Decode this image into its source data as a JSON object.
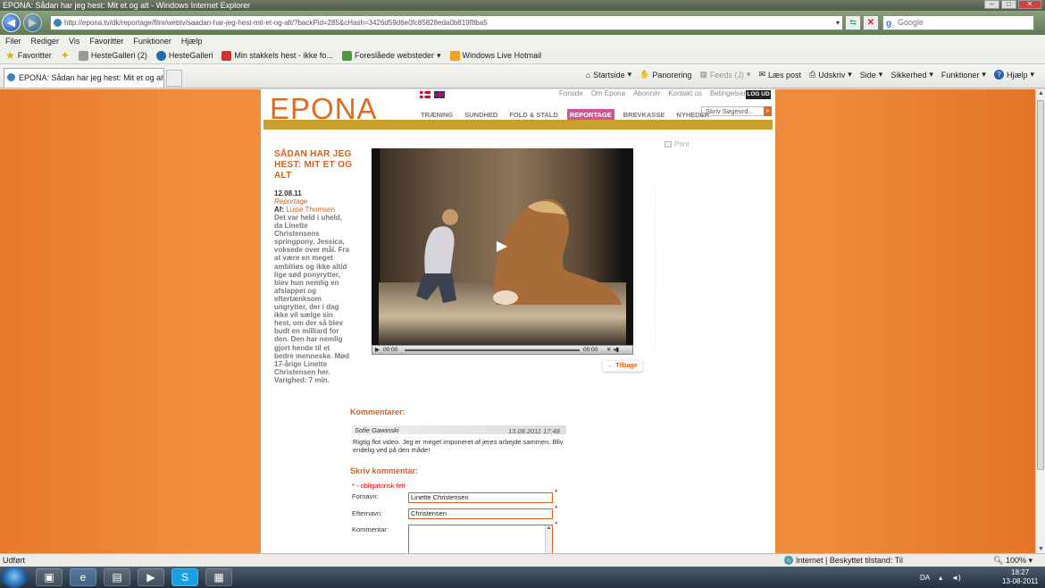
{
  "window": {
    "title": "EPONA: Sådan har jeg hest: Mit et og alt - Windows Internet Explorer",
    "address": "http://epona.tv/dk/reportage/film/webtv/saadan-har-jeg-hest-mit-et-og-alt/?backPid=285&cHash=3426d59d6e0fc85828eda0b819f8ba5",
    "search_placeholder": "Google"
  },
  "menu": [
    "Filer",
    "Rediger",
    "Vis",
    "Favoritter",
    "Funktioner",
    "Hjælp"
  ],
  "favorites_bar": {
    "favorites_label": "Favoritter",
    "items": [
      "HesteGalleri (2)",
      "HesteGalleri",
      "Min stakkels hest - ikke fo...",
      "Foreslåede websteder",
      "Windows Live Hotmail"
    ]
  },
  "tab": {
    "title": "EPONA: Sådan har jeg hest: Mit et og alt"
  },
  "command_bar": {
    "home": "Startside",
    "panorering": "Panorering",
    "feeds": "Feeds (J)",
    "read_mail": "Læs post",
    "print": "Udskriv",
    "page": "Side",
    "safety": "Sikkerhed",
    "tools": "Funktioner",
    "help": "Hjælp"
  },
  "site": {
    "logo": "EPONA",
    "top_links": [
      "Forside",
      "Om Epona",
      "Abonnér",
      "Kontakt os",
      "Betingelser"
    ],
    "logout": "LOG UD",
    "nav": [
      "TRÆNING",
      "SUNDHED",
      "FOLD & STALD",
      "REPORTAGE",
      "BREVKASSE",
      "NYHEDER"
    ],
    "active_nav": "REPORTAGE",
    "search_placeholder": "Skriv Søgeord...",
    "search_button": "»"
  },
  "article": {
    "title": "SÅDAN HAR JEG HEST: MIT ET OG ALT",
    "date": "12.08.11",
    "category": "Reportage",
    "author_prefix": "Af:",
    "author": "Luise Thomsen",
    "body": "Det var held i uheld, da Linette Christensens springpony, Jessica, voksede over mål. Fra at være en meget ambitiøs og ikke altid lige sød ponyrytter, blev hun nemlig en afslappet og eftertænksom ungrytter, der i dag ikke vil sælge sin hest, om der så blev budt en milliard for den. Den har nemlig gjort hende til et bedre menneske. Mød 17-årige Linette Christensen her. Varighed: 7 min.",
    "print": "Print",
    "back": "← Tilbage",
    "video": {
      "time_current": "00:00",
      "time_total": "00:00",
      "progress": 0
    }
  },
  "comments": {
    "heading": "Kommentarer:",
    "items": [
      {
        "author": "Sofie Gawinski",
        "date": "13.08.2011 17:48",
        "text": "Rigtig flot video. Jeg er meget imponeret af jeres arbejde sammen. Bliv endelig ved på den måde!"
      }
    ]
  },
  "comment_form": {
    "heading": "Skriv kommentar:",
    "required_marker": "*",
    "required_note": " - obligatorisk felt",
    "first_name_label": "Fornavn:",
    "first_name_value": "Linette Christensen",
    "last_name_label": "Efternavn:",
    "last_name_value": "Christensen",
    "comment_label": "Kommentar:"
  },
  "status_bar": {
    "status": "Udført",
    "zone": "Internet | Beskyttet tilstand: Til",
    "zoom": "100%"
  },
  "taskbar": {
    "language": "DA",
    "time": "18:27",
    "date": "13-08-2011"
  },
  "colors": {
    "accent_orange": "#e26b1f",
    "active_nav_pink": "#d6509a",
    "gold_bar": "#c9a02c"
  }
}
